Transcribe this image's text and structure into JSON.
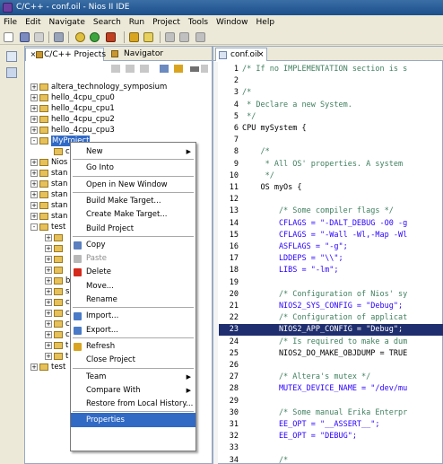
{
  "window": {
    "title": "C/C++ - conf.oil - Nios II IDE"
  },
  "menubar": [
    "File",
    "Edit",
    "Navigate",
    "Search",
    "Run",
    "Project",
    "Tools",
    "Window",
    "Help"
  ],
  "left_panel": {
    "tabs": [
      {
        "label": "C/C++ Projects",
        "active": true
      },
      {
        "label": "Navigator",
        "active": false
      }
    ],
    "tree": [
      {
        "label": "altera_technology_symposium",
        "expander": "+"
      },
      {
        "label": "hello_4cpu_cpu0",
        "expander": "+"
      },
      {
        "label": "hello_4cpu_cpu1",
        "expander": "+"
      },
      {
        "label": "hello_4cpu_cpu2",
        "expander": "+"
      },
      {
        "label": "hello_4cpu_cpu3",
        "expander": "+"
      },
      {
        "label": "MyProject",
        "expander": "-",
        "selected": true
      },
      {
        "label": "c",
        "expander": ""
      },
      {
        "label": "Nios",
        "expander": "+"
      },
      {
        "label": "stan",
        "expander": "+"
      },
      {
        "label": "stan",
        "expander": "+"
      },
      {
        "label": "stan",
        "expander": "+"
      },
      {
        "label": "stan",
        "expander": "+"
      },
      {
        "label": "stan",
        "expander": "+"
      },
      {
        "label": "test",
        "expander": "-"
      },
      {
        "label": "",
        "expander": "+"
      },
      {
        "label": "",
        "expander": "+"
      },
      {
        "label": "",
        "expander": "+"
      },
      {
        "label": "",
        "expander": "+"
      },
      {
        "label": "b",
        "expander": "+"
      },
      {
        "label": "s",
        "expander": "+"
      },
      {
        "label": "c",
        "expander": "+"
      },
      {
        "label": "c",
        "expander": "+"
      },
      {
        "label": "c",
        "expander": "+"
      },
      {
        "label": "c",
        "expander": "+"
      },
      {
        "label": "t",
        "expander": "+"
      },
      {
        "label": "t",
        "expander": "+"
      },
      {
        "label": "test",
        "expander": "+"
      }
    ]
  },
  "context_menu": {
    "items": [
      {
        "label": "New",
        "submenu": true
      },
      {
        "separator": true
      },
      {
        "label": "Go Into"
      },
      {
        "separator": true
      },
      {
        "label": "Open in New Window"
      },
      {
        "separator": true
      },
      {
        "label": "Build Make Target..."
      },
      {
        "label": "Create Make Target..."
      },
      {
        "label": "Build Project"
      },
      {
        "separator": true
      },
      {
        "label": "Copy",
        "icon": "copy-icon",
        "icon_color": "#5b7fbf"
      },
      {
        "label": "Paste",
        "icon": "paste-icon",
        "icon_color": "#b8b8b8",
        "disabled": true
      },
      {
        "label": "Delete",
        "icon": "delete-icon",
        "icon_color": "#d42a1c"
      },
      {
        "label": "Move..."
      },
      {
        "label": "Rename"
      },
      {
        "separator": true
      },
      {
        "label": "Import...",
        "icon": "import-icon",
        "icon_color": "#4a7bc8"
      },
      {
        "label": "Export...",
        "icon": "export-icon",
        "icon_color": "#4a7bc8"
      },
      {
        "separator": true
      },
      {
        "label": "Refresh",
        "icon": "refresh-icon",
        "icon_color": "#d9a520"
      },
      {
        "label": "Close Project"
      },
      {
        "separator": true
      },
      {
        "label": "Team",
        "submenu": true
      },
      {
        "label": "Compare With",
        "submenu": true
      },
      {
        "label": "Restore from Local History..."
      },
      {
        "separator": true
      },
      {
        "label": "Properties",
        "highlighted": true
      }
    ]
  },
  "editor": {
    "tab_label": "conf.oil",
    "highlight_line": 23,
    "lines": [
      {
        "num": "1",
        "text": "/* If no IMPLEMENTATION section is s",
        "style": "comment"
      },
      {
        "num": "2",
        "text": "",
        "style": "plain"
      },
      {
        "num": "3",
        "text": "/*",
        "style": "comment"
      },
      {
        "num": "4",
        "text": " * Declare a new System.",
        "style": "comment"
      },
      {
        "num": "5",
        "text": " */",
        "style": "comment"
      },
      {
        "num": "6",
        "text": "CPU mySystem {",
        "style": "plain"
      },
      {
        "num": "7",
        "text": "",
        "style": "plain"
      },
      {
        "num": "8",
        "text": "    /*",
        "style": "comment"
      },
      {
        "num": "9",
        "text": "     * All OS' properties. A system",
        "style": "comment"
      },
      {
        "num": "10",
        "text": "     */",
        "style": "comment"
      },
      {
        "num": "11",
        "text": "    OS myOs {",
        "style": "plain"
      },
      {
        "num": "12",
        "text": "",
        "style": "plain"
      },
      {
        "num": "13",
        "text": "        /* Some compiler flags */",
        "style": "comment"
      },
      {
        "num": "14",
        "text": "        CFLAGS = \"-DALT_DEBUG -O0 -g",
        "style": "assign"
      },
      {
        "num": "15",
        "text": "        CFLAGS = \"-Wall -Wl,-Map -Wl",
        "style": "assign"
      },
      {
        "num": "16",
        "text": "        ASFLAGS = \"-g\";",
        "style": "assign"
      },
      {
        "num": "17",
        "text": "        LDDEPS = \"\\\\\";",
        "style": "assign"
      },
      {
        "num": "18",
        "text": "        LIBS = \"-lm\";",
        "style": "assign"
      },
      {
        "num": "19",
        "text": "",
        "style": "plain"
      },
      {
        "num": "20",
        "text": "        /* Configuration of Nios' sy",
        "style": "comment"
      },
      {
        "num": "21",
        "text": "        NIOS2_SYS_CONFIG = \"Debug\";",
        "style": "assign"
      },
      {
        "num": "22",
        "text": "        /* Configuration of applicat",
        "style": "comment"
      },
      {
        "num": "23",
        "text": "        NIOS2_APP_CONFIG = \"Debug\";",
        "style": "assign"
      },
      {
        "num": "24",
        "text": "        /* Is required to make a dum",
        "style": "comment"
      },
      {
        "num": "25",
        "text": "        NIOS2_DO_MAKE_OBJDUMP = TRUE",
        "style": "plain"
      },
      {
        "num": "26",
        "text": "",
        "style": "plain"
      },
      {
        "num": "27",
        "text": "        /* Altera's mutex */",
        "style": "comment"
      },
      {
        "num": "28",
        "text": "        MUTEX_DEVICE_NAME = \"/dev/mu",
        "style": "assign"
      },
      {
        "num": "29",
        "text": "",
        "style": "plain"
      },
      {
        "num": "30",
        "text": "        /* Some manual Erika Enterpr",
        "style": "comment"
      },
      {
        "num": "31",
        "text": "        EE_OPT = \"__ASSERT__\";",
        "style": "assign"
      },
      {
        "num": "32",
        "text": "        EE_OPT = \"DEBUG\";",
        "style": "assign"
      },
      {
        "num": "33",
        "text": "",
        "style": "plain"
      },
      {
        "num": "34",
        "text": "        /*",
        "style": "comment"
      }
    ]
  }
}
